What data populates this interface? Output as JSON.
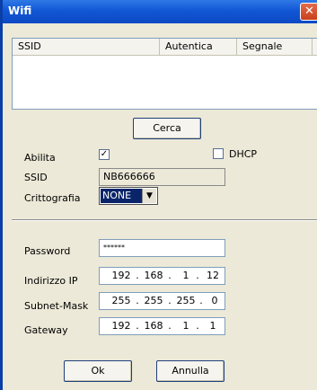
{
  "window": {
    "title": "Wifi",
    "close_glyph": "✕"
  },
  "list": {
    "columns": [
      "SSID",
      "Autentica",
      "Segnale"
    ]
  },
  "buttons": {
    "search": "Cerca",
    "ok": "Ok",
    "cancel": "Annulla"
  },
  "form": {
    "enable_label": "Abilita",
    "enable_checked": "✓",
    "dhcp_label": "DHCP",
    "dhcp_checked": "",
    "ssid_label": "SSID",
    "ssid_value": "NB666666",
    "crypto_label": "Crittografia",
    "crypto_value": "NONE",
    "password_label": "Password",
    "password_value": "******",
    "ip_label": "Indirizzo IP",
    "ip": [
      "192",
      "168",
      "1",
      "12"
    ],
    "mask_label": "Subnet-Mask",
    "mask": [
      "255",
      "255",
      "255",
      "0"
    ],
    "gw_label": "Gateway",
    "gw": [
      "192",
      "168",
      "1",
      "1"
    ]
  },
  "icons": {
    "dropdown": "chevron-down-icon",
    "close": "close-icon",
    "check": "check-icon"
  }
}
